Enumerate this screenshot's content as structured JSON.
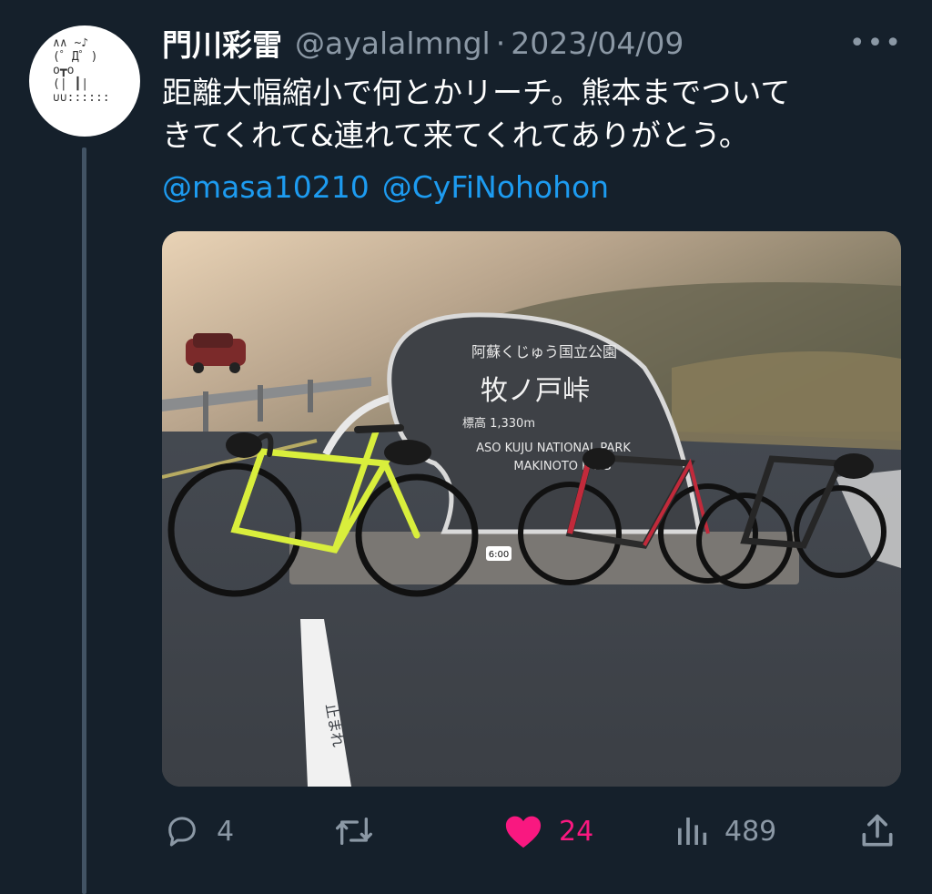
{
  "tweet": {
    "display_name": "門川彩雷",
    "handle": "@ayalalmngl",
    "separator": "·",
    "date": "2023/04/09",
    "more_label": "•••",
    "text_line1": "距離大幅縮小で何とかリーチ。熊本までついて",
    "text_line2": "きてくれて&連れて来てくれてありがとう。",
    "mentions": [
      "@masa10210",
      "@CyFiNohohon"
    ],
    "avatar_art": "∧∧ ~♪\n(゜Д゜)\no┳o\n(| ┃|\n∪∪::::::"
  },
  "photo": {
    "sign_line1": "阿蘇くじゅう国立公園",
    "sign_line2": "牧ノ戸峠",
    "sign_line3": "標高 1,330m",
    "sign_line4": "ASO KUJU NATIONAL PARK",
    "sign_line5": "MAKINOTO PASS",
    "stamp": "6:00",
    "road_marking": "止まれ"
  },
  "actions": {
    "reply_count": "4",
    "retweet_count": "",
    "like_count": "24",
    "views_count": "489"
  },
  "colors": {
    "background": "#15202b",
    "text": "#ffffff",
    "muted": "#8b98a5",
    "link": "#1d9bf0",
    "like": "#f91880"
  }
}
